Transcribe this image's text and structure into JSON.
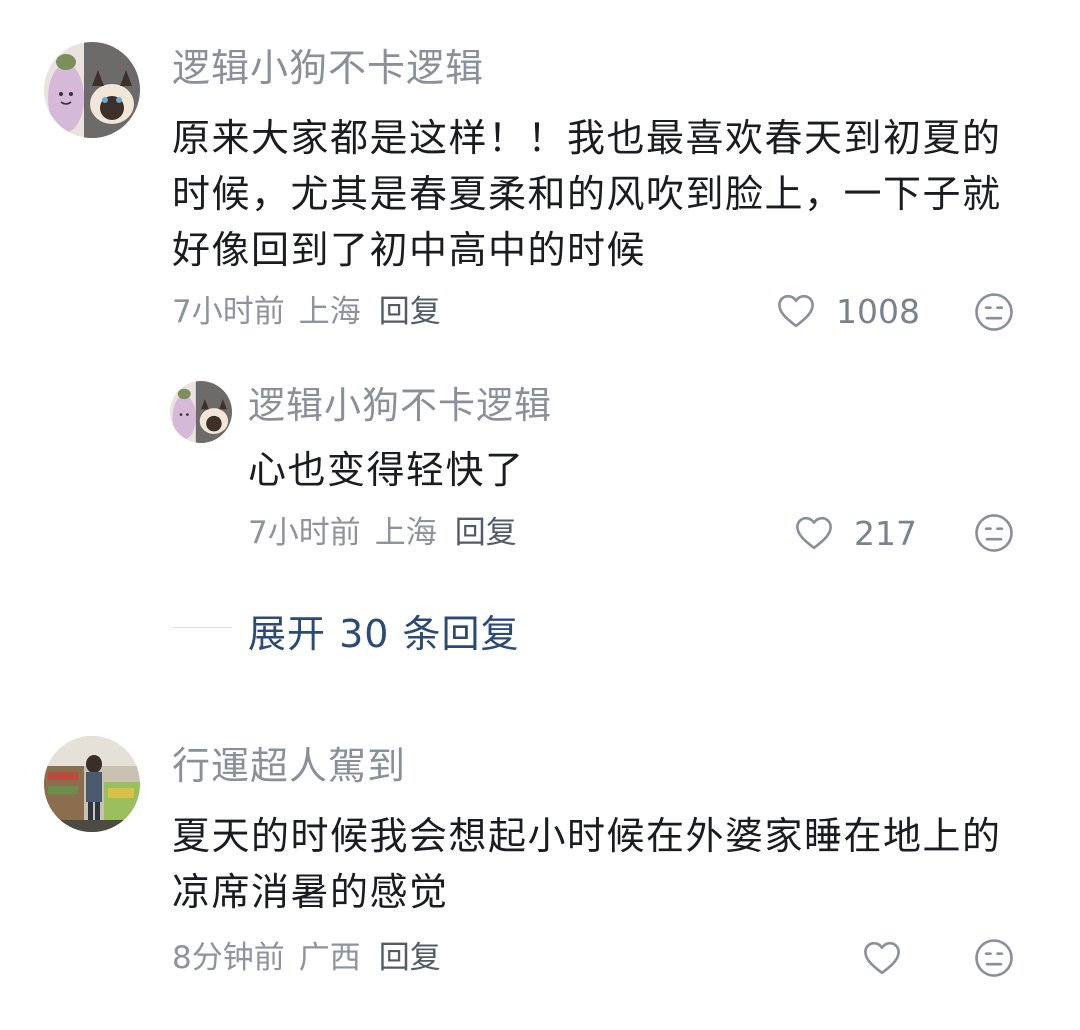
{
  "comments": [
    {
      "username": "逻辑小狗不卡逻辑",
      "text": "原来大家都是这样！！我也最喜欢春天到初夏的时候，尤其是春夏柔和的风吹到脸上，一下子就好像回到了初中高中的时候",
      "time": "7小时前",
      "location": "上海",
      "reply_label": "回复",
      "like_count": "1008",
      "reply": {
        "username": "逻辑小狗不卡逻辑",
        "text": "心也变得轻快了",
        "time": "7小时前",
        "location": "上海",
        "reply_label": "回复",
        "like_count": "217"
      },
      "expand_label": "展开 30 条回复"
    },
    {
      "username": "行運超人駕到",
      "text": "夏天的时候我会想起小时候在外婆家睡在地上的凉席消暑的感觉",
      "time": "8分钟前",
      "location": "广西",
      "reply_label": "回复",
      "like_count": ""
    }
  ],
  "icons": {
    "like": "heart-outline-icon",
    "dislike": "meh-face-icon"
  },
  "colors": {
    "username": "#8a8f99",
    "text": "#1a1c21",
    "meta": "#8e939c",
    "expand": "#2b4a78"
  }
}
